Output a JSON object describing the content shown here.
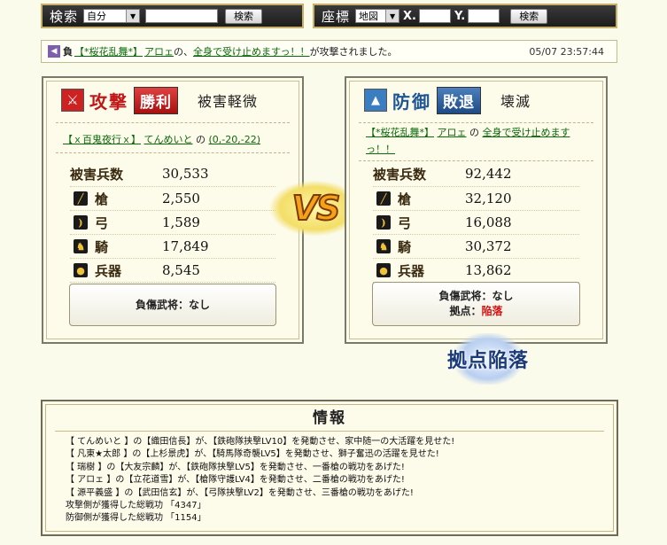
{
  "search_bar": {
    "label": "検索",
    "select_value": "自分",
    "input_value": "",
    "button_label": "検索"
  },
  "coord_bar": {
    "label": "座標",
    "select_value": "地図",
    "x_label": "X.",
    "x_value": "",
    "y_label": "Y.",
    "y_value": "",
    "button_label": "検索"
  },
  "report": {
    "icon": "purple-flag-icon",
    "outcome_tag": "負",
    "alliance": "【*桜花乱舞*】",
    "player": "アロェ",
    "conj1": "の、",
    "village": "全身で受け止めますっ！！",
    "suffix": "が攻撃されました。",
    "datetime": "05/07 23:57:44"
  },
  "attacker": {
    "side_icon": "crossed-swords-icon",
    "side_label": "攻撃",
    "result": "勝利",
    "damage_level": "被害軽微",
    "alliance": "【ｘ百鬼夜行ｘ】",
    "player": "てんめいと",
    "conj": "の",
    "location": "(0,-20,-22)",
    "total_label": "被害兵数",
    "total": "30,533",
    "units": [
      {
        "icon": "spear-icon",
        "label": "槍",
        "value": "2,550"
      },
      {
        "icon": "bow-icon",
        "label": "弓",
        "value": "1,589"
      },
      {
        "icon": "horse-icon",
        "label": "騎",
        "value": "17,849"
      },
      {
        "icon": "siege-icon",
        "label": "兵器",
        "value": "8,545"
      }
    ],
    "wounded_label": "負傷武将",
    "wounded_value": "：なし"
  },
  "defender": {
    "side_icon": "castle-icon",
    "side_label": "防御",
    "result": "敗退",
    "damage_level": "壊滅",
    "alliance": "【*桜花乱舞*】",
    "player": "アロェ",
    "conj": "の",
    "location": "全身で受け止めますっ！！",
    "total_label": "被害兵数",
    "total": "92,442",
    "units": [
      {
        "icon": "spear-icon",
        "label": "槍",
        "value": "32,120"
      },
      {
        "icon": "bow-icon",
        "label": "弓",
        "value": "16,088"
      },
      {
        "icon": "horse-icon",
        "label": "騎",
        "value": "30,372"
      },
      {
        "icon": "siege-icon",
        "label": "兵器",
        "value": "13,862"
      }
    ],
    "wounded_label": "負傷武将",
    "wounded_value": "：なし",
    "base_label": "拠点：",
    "base_value": "陥落"
  },
  "vs_label": "VS",
  "fallen_badge": "拠点陥落",
  "info": {
    "title": "情報",
    "lines": [
      "【 てんめいと 】の【織田信長】が、【鉄砲隊挟撃LV10】を発動させ、家中随一の大活躍を見せた!",
      "【 凡東★太郎 】の【上杉景虎】が、【騎馬隊奇襲LV5】を発動させ、獅子奮迅の活躍を見せた!",
      "【 瑞樹 】の【大友宗麟】が、【鉄砲隊挟撃LV5】を発動させ、一番槍の戦功をあげた!",
      "【 アロェ 】の【立花道雪】が、【槍隊守護LV4】を発動させ、二番槍の戦功をあげた!",
      "【 源平義盛 】の【武田信玄】が、【弓隊挟撃LV2】を発動させ、三番槍の戦功をあげた!",
      "攻撃側が獲得した総戦功 「4347」",
      "防御側が獲得した総戦功 「1154」"
    ]
  },
  "colors": {
    "attack_red": "#c01818",
    "defense_blue": "#1e5596",
    "link_green": "#0a6a0a",
    "fallen_red": "#d21616",
    "panel_bg": "#fdfbea",
    "page_bg": "#fbfbec"
  }
}
